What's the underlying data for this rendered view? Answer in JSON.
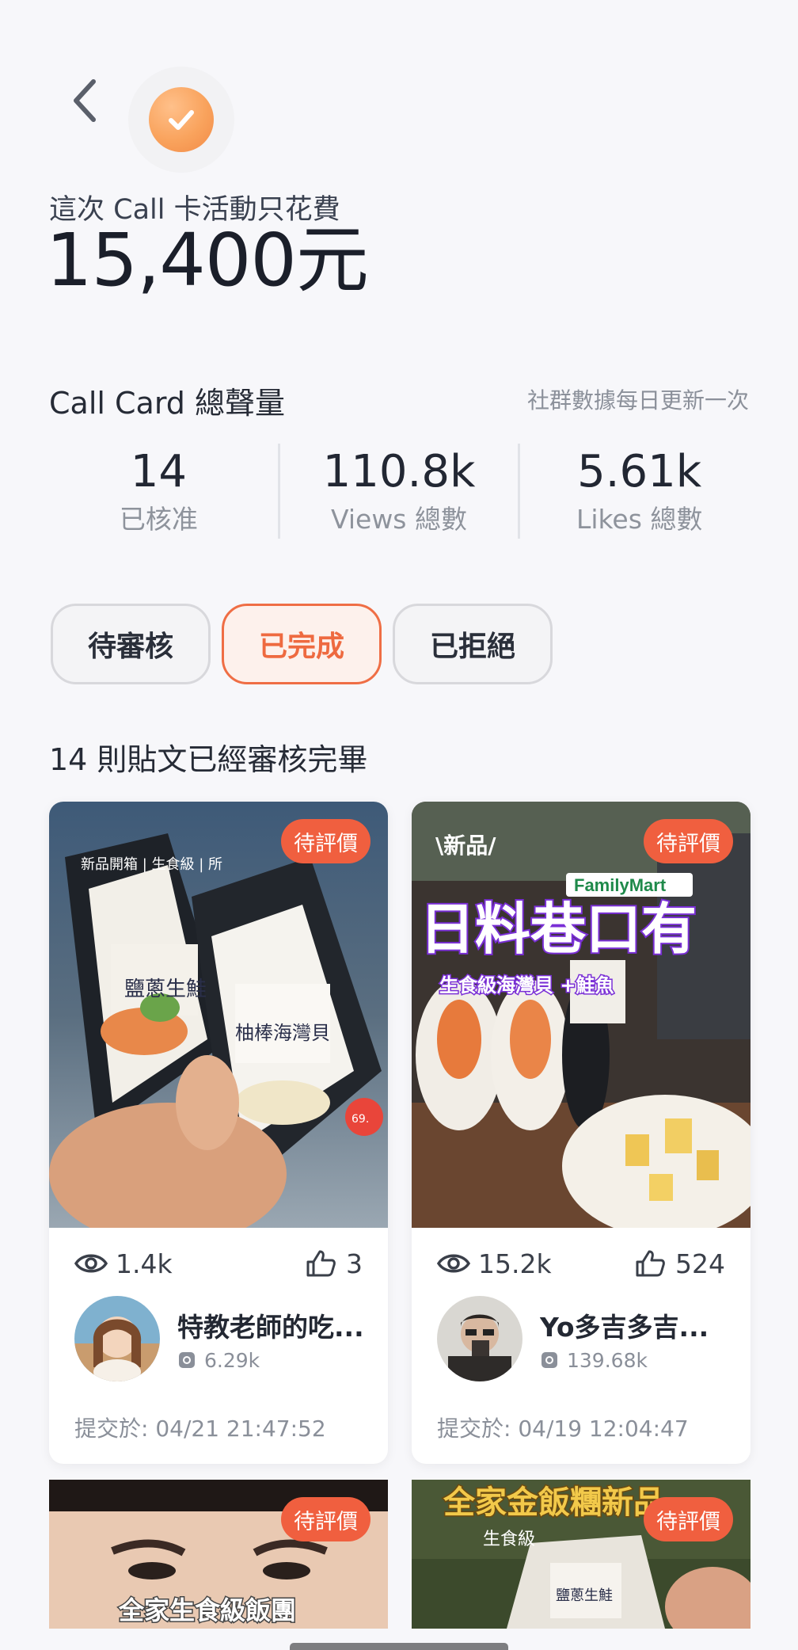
{
  "header": {
    "spend_label": "這次 Call 卡活動只花費",
    "spend_amount": "15,400元"
  },
  "summary": {
    "title": "Call Card 總聲量",
    "update_note": "社群數據每日更新一次",
    "stats": [
      {
        "value": "14",
        "label": "已核准"
      },
      {
        "value": "110.8k",
        "label": "Views 總數"
      },
      {
        "value": "5.61k",
        "label": "Likes 總數"
      }
    ]
  },
  "tabs": [
    {
      "label": "待審核",
      "active": false
    },
    {
      "label": "已完成",
      "active": true
    },
    {
      "label": "已拒絕",
      "active": false
    }
  ],
  "posts_count": "14 則貼文已經審核完畢",
  "posts": [
    {
      "badge": "待評價",
      "views": "1.4k",
      "likes": "3",
      "author_name": "特教老師的吃...",
      "followers": "6.29k",
      "submitted": "提交於: 04/21 21:47:52",
      "thumb_texts": [
        "新品開箱 | 生食級 | 所",
        "鹽蔥生鮭",
        "柚棒海灣貝",
        "69."
      ]
    },
    {
      "badge": "待評價",
      "views": "15.2k",
      "likes": "524",
      "author_name": "Yo多吉多吉...",
      "followers": "139.68k",
      "submitted": "提交於: 04/19 12:04:47",
      "thumb_texts": [
        "\\新品/",
        "FamilyMart",
        "日料巷口有",
        "生食級海灣貝 +鮭魚"
      ]
    },
    {
      "badge": "待評價",
      "thumb_texts": [
        "全家生食級飯團"
      ]
    },
    {
      "badge": "待評價",
      "thumb_texts": [
        "全家金飯糰新品",
        "生食級",
        "鹽蔥生鮭"
      ]
    }
  ],
  "icons": {
    "back": "chevron-left-icon",
    "check": "check-circle-icon",
    "views": "eye-icon",
    "likes": "thumbs-up-icon",
    "followers": "instagram-icon"
  },
  "colors": {
    "accent": "#ee6a40",
    "badge": "#f05f3f",
    "check_gradient": "#f9a35d",
    "background": "#f7f7fa"
  }
}
